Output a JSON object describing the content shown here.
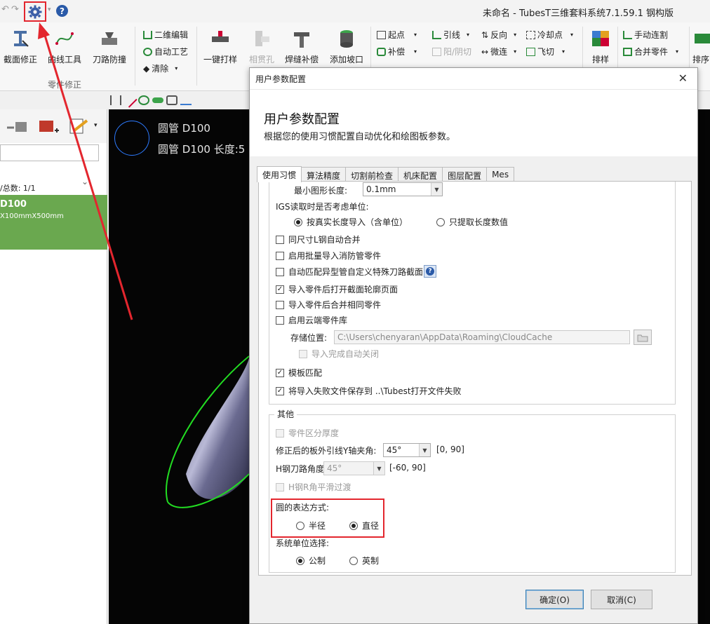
{
  "app": {
    "title": "未命名 - TubesT三维套料系统7.1.59.1 钢构版",
    "quick_access": [
      "↶",
      "↷"
    ],
    "help_icon": "?"
  },
  "ribbon": {
    "big": [
      {
        "label": "截面修正",
        "icon": "section-fix-icon"
      },
      {
        "label": "曲线工具",
        "icon": "curve-tool-icon"
      },
      {
        "label": "刀路防撞",
        "icon": "anti-collision-icon"
      },
      {
        "label": "一键打样",
        "icon": "one-key-sample-icon"
      },
      {
        "label": "相贯孔",
        "icon": "intersect-hole-icon",
        "disabled": true
      },
      {
        "label": "焊缝补偿",
        "icon": "weld-compensate-icon"
      },
      {
        "label": "添加坡口",
        "icon": "add-bevel-icon"
      },
      {
        "label": "排样",
        "icon": "nesting-icon"
      },
      {
        "label": "排序",
        "icon": "sort-icon"
      }
    ],
    "small": [
      {
        "label": "二维编辑"
      },
      {
        "label": "自动工艺"
      },
      {
        "label": "清除"
      },
      {
        "label": "起点"
      },
      {
        "label": "补偿"
      },
      {
        "label": "引线"
      },
      {
        "label": "阳/阴切",
        "disabled": true
      },
      {
        "label": "反向"
      },
      {
        "label": "微连"
      },
      {
        "label": "冷却点"
      },
      {
        "label": "飞切"
      },
      {
        "label": "手动连割"
      },
      {
        "label": "合并零件"
      }
    ],
    "group_label": "零件修正"
  },
  "left_panel": {
    "count_label": "/总数: 1/1",
    "part_name": "D100",
    "part_size": "X100mmX500mm"
  },
  "canvas": {
    "line1": "圆管 D100",
    "line2": "圆管 D100 长度:5"
  },
  "dialog": {
    "window_title": "用户参数配置",
    "heading": "用户参数配置",
    "subtitle": "根据您的使用习惯配置自动优化和绘图板参数。",
    "close": "✕",
    "tabs": [
      {
        "label": "使用习惯",
        "active": true
      },
      {
        "label": "算法精度"
      },
      {
        "label": "切割前检查"
      },
      {
        "label": "机床配置"
      },
      {
        "label": "图层配置"
      },
      {
        "label": "Mes"
      }
    ],
    "min_length_label": "最小图形长度:",
    "min_length_value": "0.1mm",
    "igs_label": "IGS读取时是否考虑单位:",
    "igs_opt1": "按真实长度导入（含单位）",
    "igs_opt2": "只提取长度数值",
    "cb_same_size": "同尺寸L钢自动合并",
    "cb_batch_fire": "启用批量导入消防管零件",
    "cb_auto_match": "自动匹配异型管自定义特殊刀路截面",
    "cb_open_profile": "导入零件后打开截面轮廓页面",
    "cb_merge_same": "导入零件后合并相同零件",
    "cb_cloud": "启用云端零件库",
    "storage_label": "存储位置:",
    "storage_path": "C:\\Users\\chenyaran\\AppData\\Roaming\\CloudCache",
    "cb_auto_close": "导入完成自动关闭",
    "cb_template": "模板匹配",
    "cb_save_fail": "将导入失败文件保存到  ..\\Tubest打开文件失败",
    "other_legend": "其他",
    "cb_thickness": "零件区分厚度",
    "plate_angle_label": "修正后的板外引线Y轴夹角:",
    "plate_angle_value": "45°",
    "plate_angle_range": "[0, 90]",
    "h_angle_label": "H钢刀路角度",
    "h_angle_value": "45°",
    "h_angle_range": "[-60, 90]",
    "cb_h_smooth": "H钢R角平滑过渡",
    "circle_label": "圆的表达方式:",
    "circle_radius": "半径",
    "circle_diameter": "直径",
    "unit_label": "系统单位选择:",
    "unit_metric": "公制",
    "unit_imperial": "英制",
    "ok": "确定(O)",
    "cancel": "取消(C)"
  }
}
